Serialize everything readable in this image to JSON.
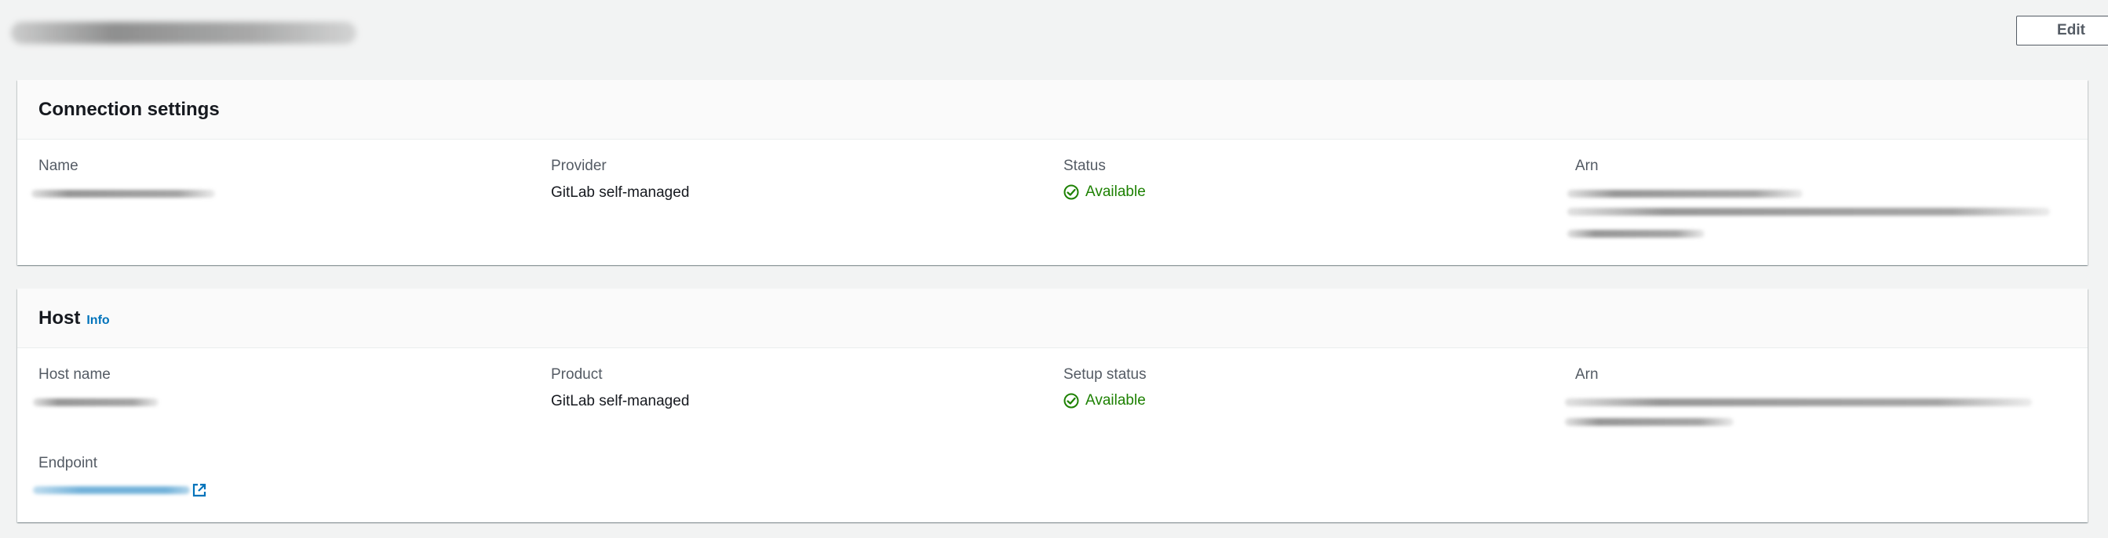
{
  "header": {
    "edit_label": "Edit"
  },
  "connection_settings": {
    "title": "Connection settings",
    "name_label": "Name",
    "provider_label": "Provider",
    "provider_value": "GitLab self-managed",
    "status_label": "Status",
    "status_value": "Available",
    "arn_label": "Arn"
  },
  "host": {
    "title": "Host",
    "info_label": "Info",
    "host_name_label": "Host name",
    "product_label": "Product",
    "product_value": "GitLab self-managed",
    "setup_status_label": "Setup status",
    "setup_status_value": "Available",
    "arn_label": "Arn",
    "endpoint_label": "Endpoint"
  },
  "colors": {
    "status_available": "#1d8102",
    "link": "#0073bb"
  },
  "icons": [
    "check-circle-icon",
    "external-link-icon"
  ]
}
